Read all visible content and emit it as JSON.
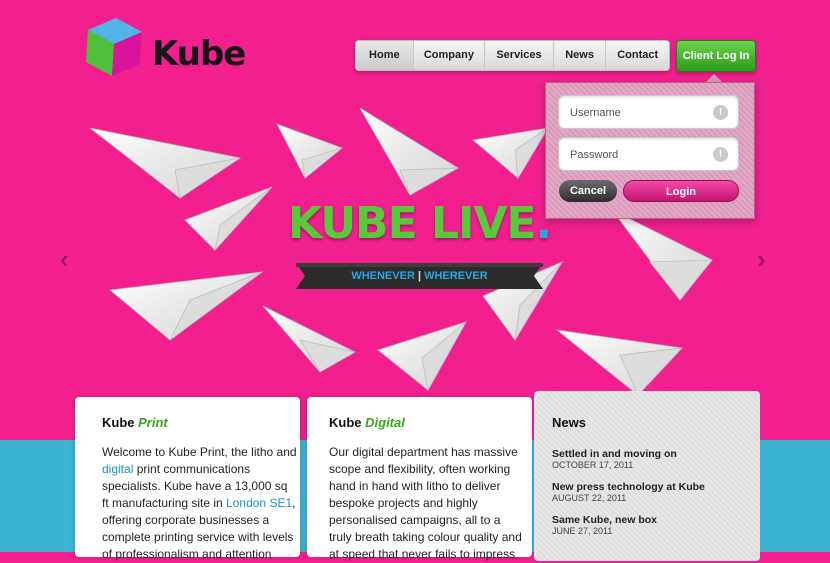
{
  "brand": {
    "name": "Kube"
  },
  "nav": {
    "items": [
      "Home",
      "Company",
      "Services",
      "News",
      "Contact"
    ],
    "client_login": "Client Log In"
  },
  "login": {
    "username_placeholder": "Username",
    "password_placeholder": "Password",
    "info_glyph": "!",
    "cancel_label": "Cancel",
    "login_label": "Login"
  },
  "hero": {
    "headline": "KUBE LIVE",
    "headline_dot": ".",
    "ribbon_left": "WHENEVER",
    "ribbon_sep": "|",
    "ribbon_right": "WHEREVER",
    "prev_glyph": "‹",
    "next_glyph": "›"
  },
  "cards": {
    "print": {
      "title_prefix": "Kube",
      "title_accent": "Print",
      "text_1": "Welcome to Kube Print, the litho and",
      "link_1": "digital",
      "text_2": " print communications specialists. Kube have a 13,000 sq ft manufacturing site in ",
      "link_2": "London SE1",
      "text_3": ", offering corporate businesses a complete printing service with levels of professionalism and attention"
    },
    "digital": {
      "title_prefix": "Kube",
      "title_accent": "Digital",
      "text": "Our digital department has massive scope and flexibility, often working hand in hand with litho to deliver bespoke projects and highly personalised campaigns, all to a truly breath taking colour quality and at speed that never fails to impress"
    }
  },
  "news": {
    "heading": "News",
    "items": [
      {
        "title": "Settled in and moving on",
        "date": "OCTOBER 17, 2011"
      },
      {
        "title": "New press technology at Kube",
        "date": "AUGUST 22, 2011"
      },
      {
        "title": "Same Kube, new box",
        "date": "JUNE 27, 2011"
      }
    ]
  },
  "colors": {
    "background": "#f2208f",
    "accent_green": "#59c83a",
    "accent_blue": "#2aa6e0",
    "band": "#3db3d2"
  }
}
